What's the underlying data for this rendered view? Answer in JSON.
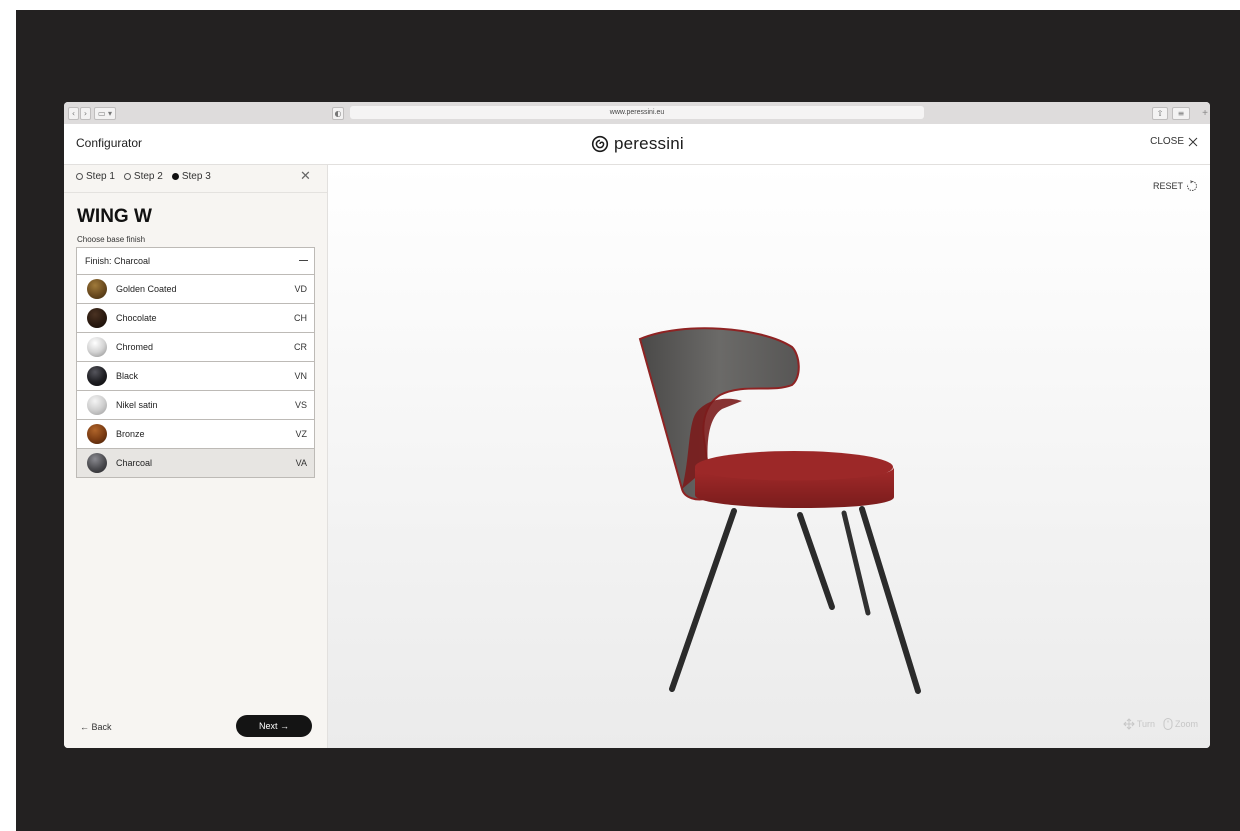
{
  "browser": {
    "url": "www.peressini.eu"
  },
  "header": {
    "title": "Configurator",
    "brand": "peressini",
    "close_label": "CLOSE"
  },
  "steps": [
    {
      "label": "Step 1",
      "active": false
    },
    {
      "label": "Step 2",
      "active": false
    },
    {
      "label": "Step 3",
      "active": true
    }
  ],
  "product": {
    "name": "WING W",
    "prompt": "Choose base finish"
  },
  "finish": {
    "current_label": "Finish: Charcoal",
    "options": [
      {
        "name": "Golden Coated",
        "code": "VD",
        "color": "#6a4a1e"
      },
      {
        "name": "Chocolate",
        "code": "CH",
        "color": "#2a1a10"
      },
      {
        "name": "Chromed",
        "code": "CR",
        "color": "#d4d4d4"
      },
      {
        "name": "Black",
        "code": "VN",
        "color": "#1e1e22"
      },
      {
        "name": "Nikel satin",
        "code": "VS",
        "color": "#cfcfcf"
      },
      {
        "name": "Bronze",
        "code": "VZ",
        "color": "#7a3b12"
      },
      {
        "name": "Charcoal",
        "code": "VA",
        "color": "#4a4a4e",
        "selected": true
      }
    ]
  },
  "nav": {
    "back_label": "← Back",
    "next_label": "Next →"
  },
  "viewer": {
    "reset_label": "RESET",
    "turn_label": "Turn",
    "zoom_label": "Zoom",
    "chair_colors": {
      "shell": "#5a5958",
      "upholstery": "#8f2323",
      "legs": "#2b2b2b"
    }
  }
}
